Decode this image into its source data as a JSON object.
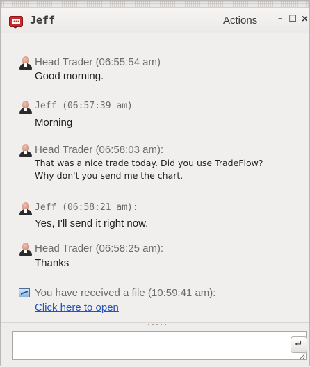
{
  "window": {
    "title": "Jeff",
    "actions_label": "Actions",
    "minimize_glyph": "–",
    "maximize_glyph": "☐",
    "close_glyph": "×"
  },
  "messages": [
    {
      "sender": "Head Trader",
      "time": "(06:55:54 am)",
      "lines": [
        "Good morning."
      ],
      "icon": "person-icon"
    },
    {
      "sender": "Jeff",
      "time": "(06:57:39 am)",
      "lines": [
        "Morning"
      ],
      "icon": "person-icon"
    },
    {
      "sender": "Head Trader",
      "time": "(06:58:03 am):",
      "lines": [
        "That was a nice trade today. Did you use TradeFlow?",
        "Why don't you send me the chart."
      ],
      "icon": "person-icon"
    },
    {
      "sender": "Jeff",
      "time": "(06:58:21 am):",
      "lines": [
        "Yes, I'll send it right now."
      ],
      "icon": "person-icon"
    },
    {
      "sender": "Head Trader",
      "time": "(06:58:25 am):",
      "lines": [
        "Thanks"
      ],
      "icon": "person-icon"
    }
  ],
  "file_notice": {
    "text": "You have received a file (10:59:41 am):",
    "link": "Click here to open",
    "icon": "chart-file-icon"
  },
  "composer": {
    "value": "",
    "send_glyph": "↵"
  },
  "colors": {
    "background": "#f1efee",
    "link": "#2255bb",
    "brand_icon": "#cc2a2a"
  }
}
